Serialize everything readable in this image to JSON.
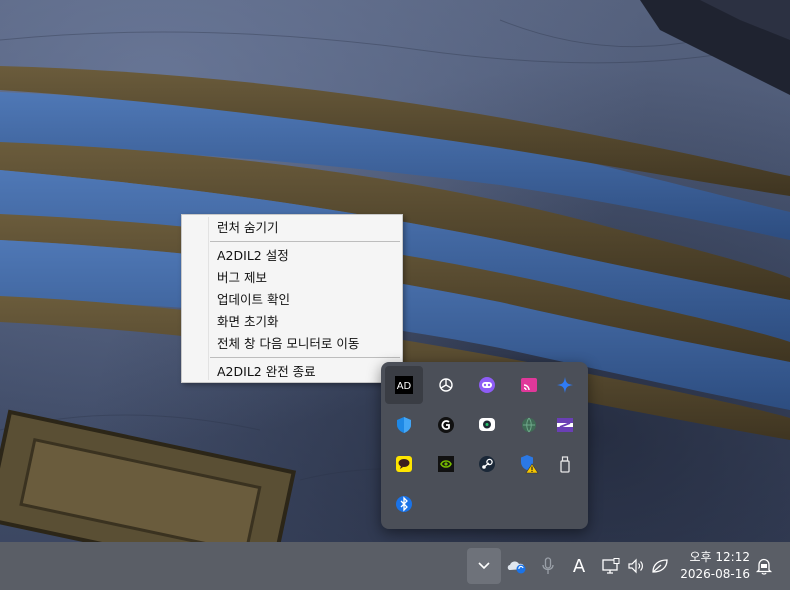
{
  "context_menu": {
    "items": [
      {
        "label": "런처 숨기기"
      },
      {
        "label": "A2DIL2 설정"
      },
      {
        "label": "버그 제보"
      },
      {
        "label": "업데이트 확인"
      },
      {
        "label": "화면 초기화"
      },
      {
        "label": "전체 창 다음 모니터로 이동"
      },
      {
        "label": "A2DIL2 완전 종료"
      }
    ]
  },
  "tray_overflow": {
    "icons": [
      {
        "name": "a2dil2-icon",
        "selected": true,
        "color": "#ffffff"
      },
      {
        "name": "chatgpt-icon",
        "color": "#ffffff"
      },
      {
        "name": "chat-bot-icon",
        "color": "#8e5cf6"
      },
      {
        "name": "cast-icon",
        "color": "#e0389a"
      },
      {
        "name": "sparkle-icon",
        "color": "#2f7bf5"
      },
      {
        "name": "defender-shield-icon",
        "color": "#1e88e5"
      },
      {
        "name": "logitech-g-icon",
        "color": "#111111"
      },
      {
        "name": "messenger-icon",
        "color": "#ffffff"
      },
      {
        "name": "globe-icon",
        "color": "#5a8f74"
      },
      {
        "name": "zigzag-app-icon",
        "color": "#6a3fb5"
      },
      {
        "name": "kakaotalk-icon",
        "color": "#fee500"
      },
      {
        "name": "nvidia-icon",
        "color": "#76b900"
      },
      {
        "name": "steam-icon",
        "color": "#1b2838"
      },
      {
        "name": "security-warning-icon",
        "color": "#2b78e4"
      },
      {
        "name": "usb-device-icon",
        "color": "#e8e8e8"
      },
      {
        "name": "bluetooth-icon",
        "color": "#1a73e8"
      }
    ]
  },
  "taskbar": {
    "show_hidden_icons": "chevron-up-icon",
    "icons": [
      "onedrive-sync-icon",
      "microphone-icon",
      "ime-indicator",
      "network-icon",
      "volume-icon",
      "efficiency-leaf-icon",
      "notification-icon"
    ],
    "ime_label": "A",
    "clock": {
      "time": "오후 12:12",
      "date": "2026-08-16"
    },
    "colors": {
      "background": "#5a5e66",
      "text": "#ffffff"
    }
  }
}
